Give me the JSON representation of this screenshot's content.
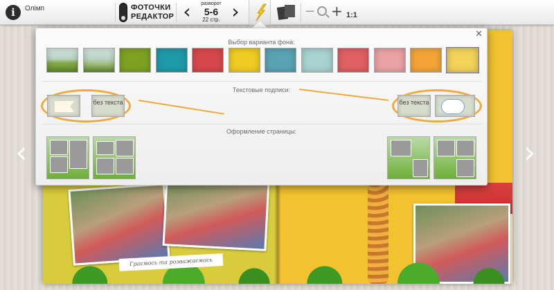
{
  "toolbar": {
    "album_title": "Олімп",
    "logo_line1": "ФОТОЧКИ",
    "logo_line2": "РЕДАКТОР",
    "spread_label": "разворот",
    "spread_number": "5-6",
    "spread_pages": "22 стр.",
    "prev_icon": "‹",
    "next_icon": "›",
    "zoom_minus": "−",
    "zoom_plus": "+",
    "zoom_reset": "1:1",
    "info_glyph": "i"
  },
  "background_panel": {
    "title": "Выбор варианта фона:",
    "close_glyph": "✕",
    "swatches": [
      {
        "name": "nature-sky",
        "color": "#86ad4a"
      },
      {
        "name": "nature-sky-light",
        "color": "#a9c58a"
      },
      {
        "name": "olive-green",
        "color": "#7da222"
      },
      {
        "name": "teal",
        "color": "#1f9aa8"
      },
      {
        "name": "red",
        "color": "#d6474c"
      },
      {
        "name": "yellow",
        "color": "#f0cc23"
      },
      {
        "name": "steel-blue",
        "color": "#5aa3b5"
      },
      {
        "name": "pale-aqua",
        "color": "#a9d3d0"
      },
      {
        "name": "rose",
        "color": "#e06064"
      },
      {
        "name": "pink",
        "color": "#eaa2a3"
      },
      {
        "name": "orange",
        "color": "#f4a437"
      },
      {
        "name": "light-yellow",
        "color": "#f5d35a"
      }
    ],
    "captions_title": "Текстовые подписи:",
    "captions_left": {
      "no_text_label": "без текста"
    },
    "captions_right": {
      "no_text_label": "без текста"
    },
    "page_design_title": "Оформление страницы:"
  },
  "album": {
    "caption_text": "Граємось та розважаємось"
  },
  "side_nav": {
    "left": "‹",
    "right": "›"
  },
  "colors": {
    "highlight": "#f0a93a",
    "page_left": "#d9cc3c",
    "page_right": "#f2c230"
  }
}
